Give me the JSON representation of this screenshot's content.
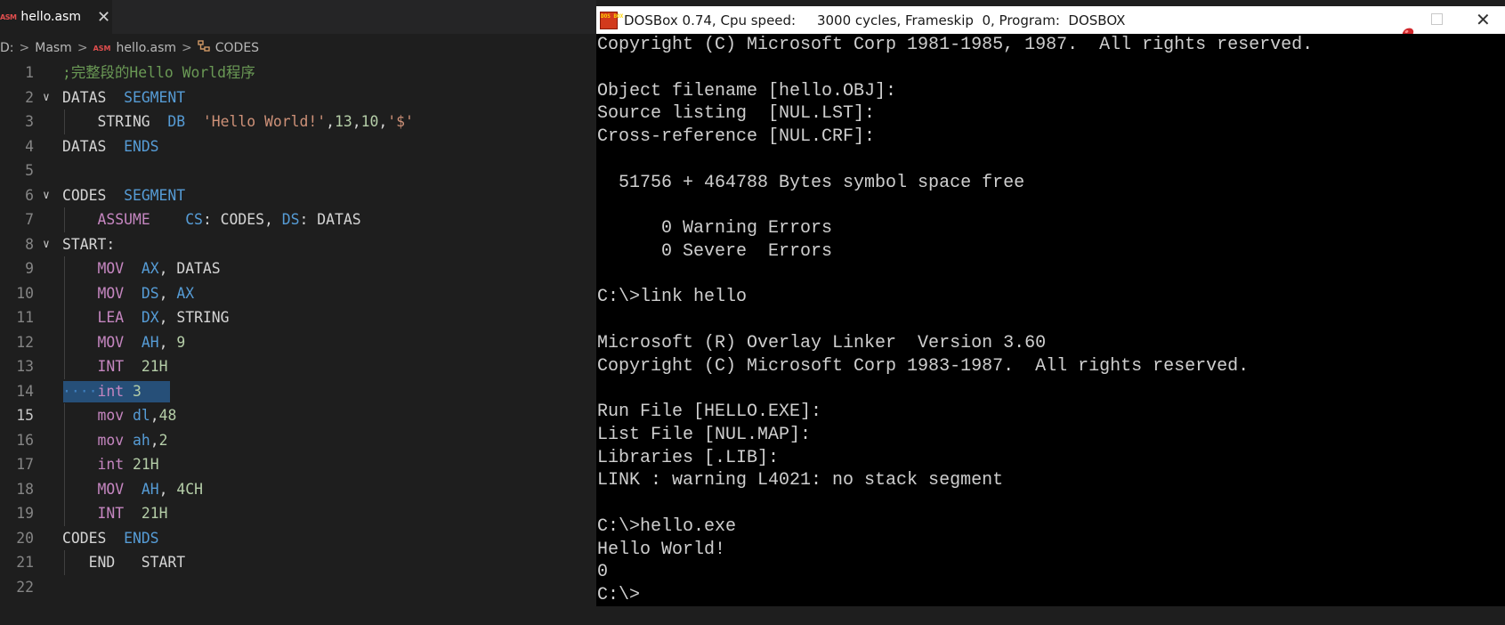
{
  "editor": {
    "tab": {
      "icon": "ASM",
      "label": "hello.asm",
      "close": "✕"
    },
    "breadcrumb": {
      "drive": "D:",
      "folder": "Masm",
      "file_icon": "ASM",
      "file": "hello.asm",
      "symbol": "CODES"
    },
    "active_line": 15,
    "selected_line": 14,
    "lines": [
      {
        "n": "1",
        "fold": false,
        "guide": false,
        "tokens": [
          {
            "t": ";完整段的Hello World程序",
            "c": "c"
          }
        ]
      },
      {
        "n": "2",
        "fold": true,
        "guide": false,
        "tokens": [
          {
            "t": "DATAS  ",
            "c": "t"
          },
          {
            "t": "SEGMENT",
            "c": "k"
          }
        ]
      },
      {
        "n": "3",
        "fold": false,
        "guide": true,
        "tokens": [
          {
            "t": "    STRING  ",
            "c": "t"
          },
          {
            "t": "DB",
            "c": "k"
          },
          {
            "t": "  ",
            "c": "t"
          },
          {
            "t": "'Hello World!'",
            "c": "s"
          },
          {
            "t": ",",
            "c": "t"
          },
          {
            "t": "13",
            "c": "n"
          },
          {
            "t": ",",
            "c": "t"
          },
          {
            "t": "10",
            "c": "n"
          },
          {
            "t": ",",
            "c": "t"
          },
          {
            "t": "'$'",
            "c": "s"
          }
        ]
      },
      {
        "n": "4",
        "fold": false,
        "guide": false,
        "tokens": [
          {
            "t": "DATAS  ",
            "c": "t"
          },
          {
            "t": "ENDS",
            "c": "k"
          }
        ]
      },
      {
        "n": "5",
        "fold": false,
        "guide": false,
        "tokens": []
      },
      {
        "n": "6",
        "fold": true,
        "guide": false,
        "tokens": [
          {
            "t": "CODES  ",
            "c": "t"
          },
          {
            "t": "SEGMENT",
            "c": "k"
          }
        ]
      },
      {
        "n": "7",
        "fold": false,
        "guide": true,
        "tokens": [
          {
            "t": "    ",
            "c": "t"
          },
          {
            "t": "ASSUME",
            "c": "i"
          },
          {
            "t": "    ",
            "c": "t"
          },
          {
            "t": "CS",
            "c": "k"
          },
          {
            "t": ": CODES, ",
            "c": "t"
          },
          {
            "t": "DS",
            "c": "k"
          },
          {
            "t": ": DATAS",
            "c": "t"
          }
        ]
      },
      {
        "n": "8",
        "fold": true,
        "guide": false,
        "tokens": [
          {
            "t": "START:",
            "c": "t"
          }
        ]
      },
      {
        "n": "9",
        "fold": false,
        "guide": true,
        "tokens": [
          {
            "t": "    ",
            "c": "t"
          },
          {
            "t": "MOV",
            "c": "i"
          },
          {
            "t": "  ",
            "c": "t"
          },
          {
            "t": "AX",
            "c": "k"
          },
          {
            "t": ", DATAS",
            "c": "t"
          }
        ]
      },
      {
        "n": "10",
        "fold": false,
        "guide": true,
        "tokens": [
          {
            "t": "    ",
            "c": "t"
          },
          {
            "t": "MOV",
            "c": "i"
          },
          {
            "t": "  ",
            "c": "t"
          },
          {
            "t": "DS",
            "c": "k"
          },
          {
            "t": ", ",
            "c": "t"
          },
          {
            "t": "AX",
            "c": "k"
          }
        ]
      },
      {
        "n": "11",
        "fold": false,
        "guide": true,
        "tokens": [
          {
            "t": "    ",
            "c": "t"
          },
          {
            "t": "LEA",
            "c": "i"
          },
          {
            "t": "  ",
            "c": "t"
          },
          {
            "t": "DX",
            "c": "k"
          },
          {
            "t": ", STRING",
            "c": "t"
          }
        ]
      },
      {
        "n": "12",
        "fold": false,
        "guide": true,
        "tokens": [
          {
            "t": "    ",
            "c": "t"
          },
          {
            "t": "MOV",
            "c": "i"
          },
          {
            "t": "  ",
            "c": "t"
          },
          {
            "t": "AH",
            "c": "k"
          },
          {
            "t": ", ",
            "c": "t"
          },
          {
            "t": "9",
            "c": "n"
          }
        ]
      },
      {
        "n": "13",
        "fold": false,
        "guide": true,
        "tokens": [
          {
            "t": "    ",
            "c": "t"
          },
          {
            "t": "INT",
            "c": "i"
          },
          {
            "t": "  ",
            "c": "t"
          },
          {
            "t": "21H",
            "c": "n"
          }
        ]
      },
      {
        "n": "14",
        "fold": false,
        "guide": false,
        "selected": true,
        "tokens": [
          {
            "t": "····",
            "c": "dots"
          },
          {
            "t": "int",
            "c": "i"
          },
          {
            "t": " ",
            "c": "t"
          },
          {
            "t": "3",
            "c": "n"
          }
        ]
      },
      {
        "n": "15",
        "fold": false,
        "guide": true,
        "tokens": [
          {
            "t": "    ",
            "c": "t"
          },
          {
            "t": "mov",
            "c": "i"
          },
          {
            "t": " ",
            "c": "t"
          },
          {
            "t": "dl",
            "c": "k"
          },
          {
            "t": ",",
            "c": "t"
          },
          {
            "t": "48",
            "c": "n"
          }
        ]
      },
      {
        "n": "16",
        "fold": false,
        "guide": true,
        "tokens": [
          {
            "t": "    ",
            "c": "t"
          },
          {
            "t": "mov",
            "c": "i"
          },
          {
            "t": " ",
            "c": "t"
          },
          {
            "t": "ah",
            "c": "k"
          },
          {
            "t": ",",
            "c": "t"
          },
          {
            "t": "2",
            "c": "n"
          }
        ]
      },
      {
        "n": "17",
        "fold": false,
        "guide": true,
        "tokens": [
          {
            "t": "    ",
            "c": "t"
          },
          {
            "t": "int",
            "c": "i"
          },
          {
            "t": " ",
            "c": "t"
          },
          {
            "t": "21H",
            "c": "n"
          }
        ]
      },
      {
        "n": "18",
        "fold": false,
        "guide": true,
        "tokens": [
          {
            "t": "    ",
            "c": "t"
          },
          {
            "t": "MOV",
            "c": "i"
          },
          {
            "t": "  ",
            "c": "t"
          },
          {
            "t": "AH",
            "c": "k"
          },
          {
            "t": ", ",
            "c": "t"
          },
          {
            "t": "4CH",
            "c": "n"
          }
        ]
      },
      {
        "n": "19",
        "fold": false,
        "guide": true,
        "tokens": [
          {
            "t": "    ",
            "c": "t"
          },
          {
            "t": "INT",
            "c": "i"
          },
          {
            "t": "  ",
            "c": "t"
          },
          {
            "t": "21H",
            "c": "n"
          }
        ]
      },
      {
        "n": "20",
        "fold": false,
        "guide": false,
        "tokens": [
          {
            "t": "CODES  ",
            "c": "t"
          },
          {
            "t": "ENDS",
            "c": "k"
          }
        ]
      },
      {
        "n": "21",
        "fold": false,
        "guide": true,
        "tokens": [
          {
            "t": "   END   START",
            "c": "t"
          }
        ]
      },
      {
        "n": "22",
        "fold": false,
        "guide": false,
        "tokens": []
      }
    ]
  },
  "dosbox": {
    "icon_text": "DOS BOX",
    "title": "DOSBox 0.74, Cpu speed:     3000 cycles, Frameskip  0, Program:  DOSBOX",
    "close": "✕",
    "lines": [
      "Copyright (C) Microsoft Corp 1981-1985, 1987.  All rights reserved.",
      "",
      "Object filename [hello.OBJ]:",
      "Source listing  [NUL.LST]:",
      "Cross-reference [NUL.CRF]:",
      "",
      "  51756 + 464788 Bytes symbol space free",
      "",
      "      0 Warning Errors",
      "      0 Severe  Errors",
      "",
      "C:\\>link hello",
      "",
      "Microsoft (R) Overlay Linker  Version 3.60",
      "Copyright (C) Microsoft Corp 1983-1987.  All rights reserved.",
      "",
      "Run File [HELLO.EXE]:",
      "List File [NUL.MAP]:",
      "Libraries [.LIB]:",
      "LINK : warning L4021: no stack segment",
      "",
      "C:\\>hello.exe",
      "Hello World!",
      "0",
      "C:\\>"
    ]
  }
}
